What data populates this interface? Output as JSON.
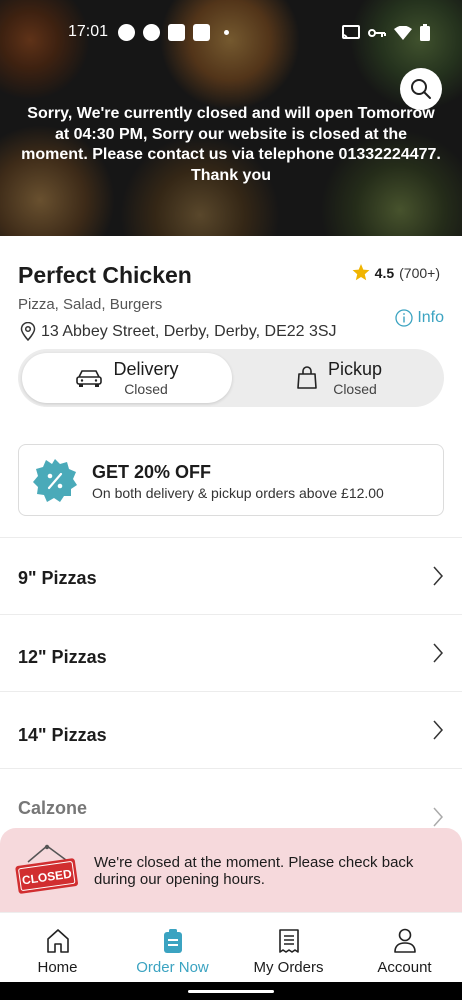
{
  "status_bar": {
    "time": "17:01"
  },
  "hero": {
    "notice": "Sorry, We're currently closed and will open Tomorrow at 04:30 PM, Sorry our website is closed at the moment. Please contact us via telephone 01332224477. Thank you",
    "search_icon": "search-icon"
  },
  "restaurant": {
    "name": "Perfect Chicken",
    "rating": "4.5",
    "rating_count": "(700+)",
    "cuisine": "Pizza, Salad, Burgers",
    "address": "13 Abbey Street, Derby, Derby, DE22 3SJ",
    "info_label": "Info"
  },
  "order_mode": {
    "delivery": {
      "label": "Delivery",
      "status": "Closed",
      "icon": "car-icon",
      "selected": true
    },
    "pickup": {
      "label": "Pickup",
      "status": "Closed",
      "icon": "bag-icon",
      "selected": false
    }
  },
  "promo": {
    "title": "GET 20% OFF",
    "subtitle": "On both delivery & pickup orders above £12.00",
    "badge_color": "#4aaab9"
  },
  "categories": [
    {
      "label": "9\" Pizzas"
    },
    {
      "label": "12\" Pizzas"
    },
    {
      "label": "14\" Pizzas"
    },
    {
      "label": "Calzone"
    }
  ],
  "closed_banner": {
    "sign_text": "CLOSED",
    "message": "We're closed at the moment. Please check back during our opening hours.",
    "background": "#f6d9dc"
  },
  "bottom_nav": [
    {
      "label": "Home",
      "icon": "home-icon",
      "active": false
    },
    {
      "label": "Order Now",
      "icon": "order-icon",
      "active": true
    },
    {
      "label": "My Orders",
      "icon": "receipt-icon",
      "active": false
    },
    {
      "label": "Account",
      "icon": "user-icon",
      "active": false
    }
  ],
  "colors": {
    "accent": "#3ba3c1",
    "star": "#f0b400",
    "closed_red": "#d12e30"
  }
}
